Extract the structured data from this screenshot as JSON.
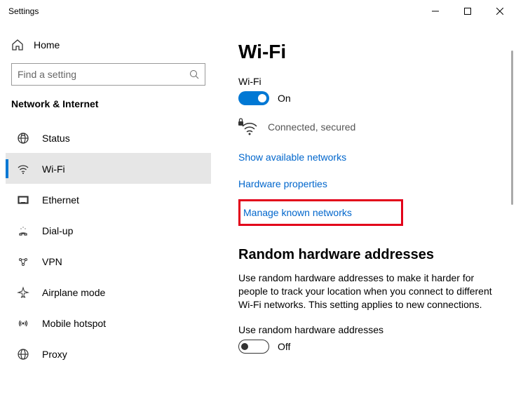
{
  "window": {
    "title": "Settings"
  },
  "sidebar": {
    "home": "Home",
    "search_placeholder": "Find a setting",
    "section": "Network & Internet",
    "items": [
      {
        "label": "Status"
      },
      {
        "label": "Wi-Fi"
      },
      {
        "label": "Ethernet"
      },
      {
        "label": "Dial-up"
      },
      {
        "label": "VPN"
      },
      {
        "label": "Airplane mode"
      },
      {
        "label": "Mobile hotspot"
      },
      {
        "label": "Proxy"
      }
    ]
  },
  "main": {
    "title": "Wi-Fi",
    "wifi_label": "Wi-Fi",
    "wifi_toggle_state": "On",
    "connection_status": "Connected, secured",
    "link_show_networks": "Show available networks",
    "link_hardware_props": "Hardware properties",
    "link_manage_known": "Manage known networks",
    "random_hdr": "Random hardware addresses",
    "random_desc": "Use random hardware addresses to make it harder for people to track your location when you connect to different Wi-Fi networks. This setting applies to new connections.",
    "random_toggle_label": "Use random hardware addresses",
    "random_toggle_state": "Off"
  }
}
